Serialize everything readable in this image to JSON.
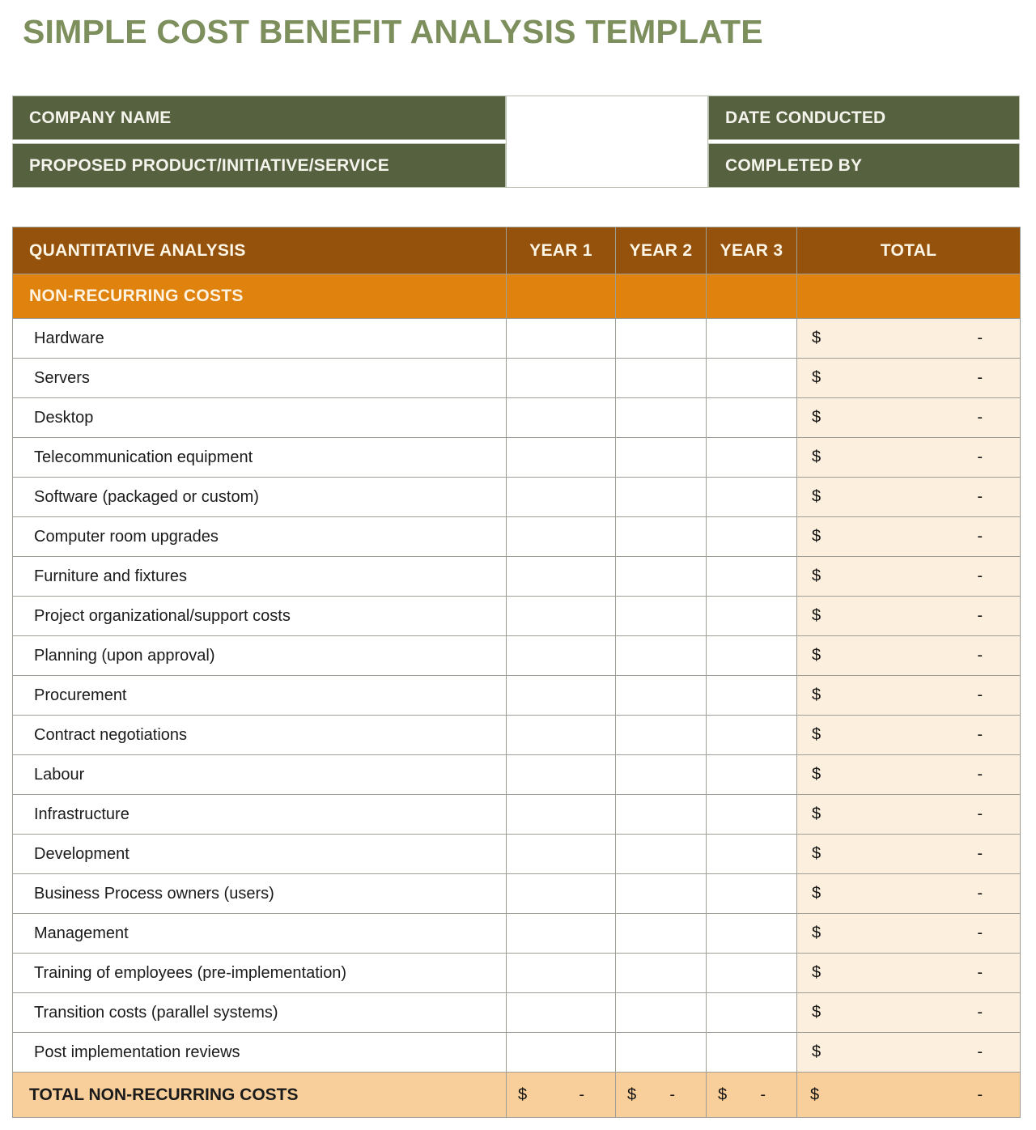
{
  "page_title": "SIMPLE COST BENEFIT ANALYSIS TEMPLATE",
  "colors": {
    "title_green": "#7d8f5c",
    "header_green": "#566140",
    "band_brown": "#95520c",
    "band_orange": "#e0820e",
    "money_cell": "#fcefdd",
    "total_row": "#f8cf9a",
    "grid_line": "#9e9e96"
  },
  "info": {
    "company_name_label": "COMPANY NAME",
    "company_name_value": "",
    "proposed_label": "PROPOSED PRODUCT/INITIATIVE/SERVICE",
    "proposed_value": "",
    "date_conducted_label": "DATE CONDUCTED",
    "date_conducted_value": "",
    "completed_by_label": "COMPLETED BY",
    "completed_by_value": ""
  },
  "table": {
    "headers": {
      "section": "QUANTITATIVE ANALYSIS",
      "year1": "YEAR 1",
      "year2": "YEAR 2",
      "year3": "YEAR 3",
      "total": "TOTAL"
    },
    "subsection": "NON-RECURRING COSTS",
    "currency_symbol": "$",
    "empty_value": "-",
    "rows": [
      {
        "label": "Hardware",
        "year1": "",
        "year2": "",
        "year3": "",
        "total_symbol": "$",
        "total_value": "-"
      },
      {
        "label": "Servers",
        "year1": "",
        "year2": "",
        "year3": "",
        "total_symbol": "$",
        "total_value": "-"
      },
      {
        "label": "Desktop",
        "year1": "",
        "year2": "",
        "year3": "",
        "total_symbol": "$",
        "total_value": "-"
      },
      {
        "label": "Telecommunication equipment",
        "year1": "",
        "year2": "",
        "year3": "",
        "total_symbol": "$",
        "total_value": "-"
      },
      {
        "label": "Software (packaged or custom)",
        "year1": "",
        "year2": "",
        "year3": "",
        "total_symbol": "$",
        "total_value": "-"
      },
      {
        "label": "Computer room upgrades",
        "year1": "",
        "year2": "",
        "year3": "",
        "total_symbol": "$",
        "total_value": "-"
      },
      {
        "label": "Furniture and fixtures",
        "year1": "",
        "year2": "",
        "year3": "",
        "total_symbol": "$",
        "total_value": "-"
      },
      {
        "label": "Project organizational/support costs",
        "year1": "",
        "year2": "",
        "year3": "",
        "total_symbol": "$",
        "total_value": "-"
      },
      {
        "label": "Planning (upon approval)",
        "year1": "",
        "year2": "",
        "year3": "",
        "total_symbol": "$",
        "total_value": "-"
      },
      {
        "label": "Procurement",
        "year1": "",
        "year2": "",
        "year3": "",
        "total_symbol": "$",
        "total_value": "-"
      },
      {
        "label": "Contract negotiations",
        "year1": "",
        "year2": "",
        "year3": "",
        "total_symbol": "$",
        "total_value": "-"
      },
      {
        "label": "Labour",
        "year1": "",
        "year2": "",
        "year3": "",
        "total_symbol": "$",
        "total_value": "-"
      },
      {
        "label": "Infrastructure",
        "year1": "",
        "year2": "",
        "year3": "",
        "total_symbol": "$",
        "total_value": "-"
      },
      {
        "label": "Development",
        "year1": "",
        "year2": "",
        "year3": "",
        "total_symbol": "$",
        "total_value": "-"
      },
      {
        "label": "Business Process owners (users)",
        "year1": "",
        "year2": "",
        "year3": "",
        "total_symbol": "$",
        "total_value": "-"
      },
      {
        "label": "Management",
        "year1": "",
        "year2": "",
        "year3": "",
        "total_symbol": "$",
        "total_value": "-"
      },
      {
        "label": "Training of employees (pre-implementation)",
        "year1": "",
        "year2": "",
        "year3": "",
        "total_symbol": "$",
        "total_value": "-"
      },
      {
        "label": "Transition costs (parallel systems)",
        "year1": "",
        "year2": "",
        "year3": "",
        "total_symbol": "$",
        "total_value": "-"
      },
      {
        "label": "Post implementation reviews",
        "year1": "",
        "year2": "",
        "year3": "",
        "total_symbol": "$",
        "total_value": "-"
      }
    ],
    "total_row": {
      "label": "TOTAL NON-RECURRING COSTS",
      "year1_symbol": "$",
      "year1_value": "-",
      "year2_symbol": "$",
      "year2_value": "-",
      "year3_symbol": "$",
      "year3_value": "-",
      "total_symbol": "$",
      "total_value": "-"
    }
  }
}
